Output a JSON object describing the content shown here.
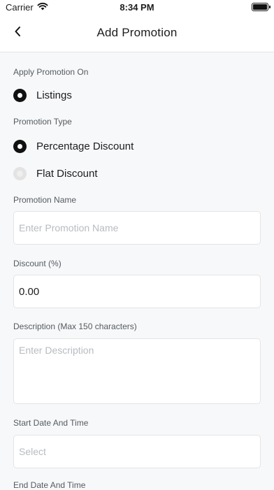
{
  "status_bar": {
    "carrier": "Carrier",
    "time": "8:34 PM"
  },
  "nav": {
    "title": "Add Promotion",
    "back_icon": "chevron-left-icon"
  },
  "apply_on": {
    "label": "Apply Promotion On",
    "options": [
      {
        "label": "Listings",
        "selected": true
      }
    ]
  },
  "promotion_type": {
    "label": "Promotion Type",
    "options": [
      {
        "label": "Percentage Discount",
        "selected": true
      },
      {
        "label": "Flat Discount",
        "selected": false
      }
    ]
  },
  "promotion_name": {
    "label": "Promotion Name",
    "placeholder": "Enter Promotion Name",
    "value": ""
  },
  "discount": {
    "label": "Discount (%)",
    "value": "0.00"
  },
  "description": {
    "label": "Description (Max 150 characters)",
    "placeholder": "Enter Description",
    "value": ""
  },
  "start_date": {
    "label": "Start Date And Time",
    "placeholder": "Select"
  },
  "end_date": {
    "label": "End Date And Time"
  }
}
